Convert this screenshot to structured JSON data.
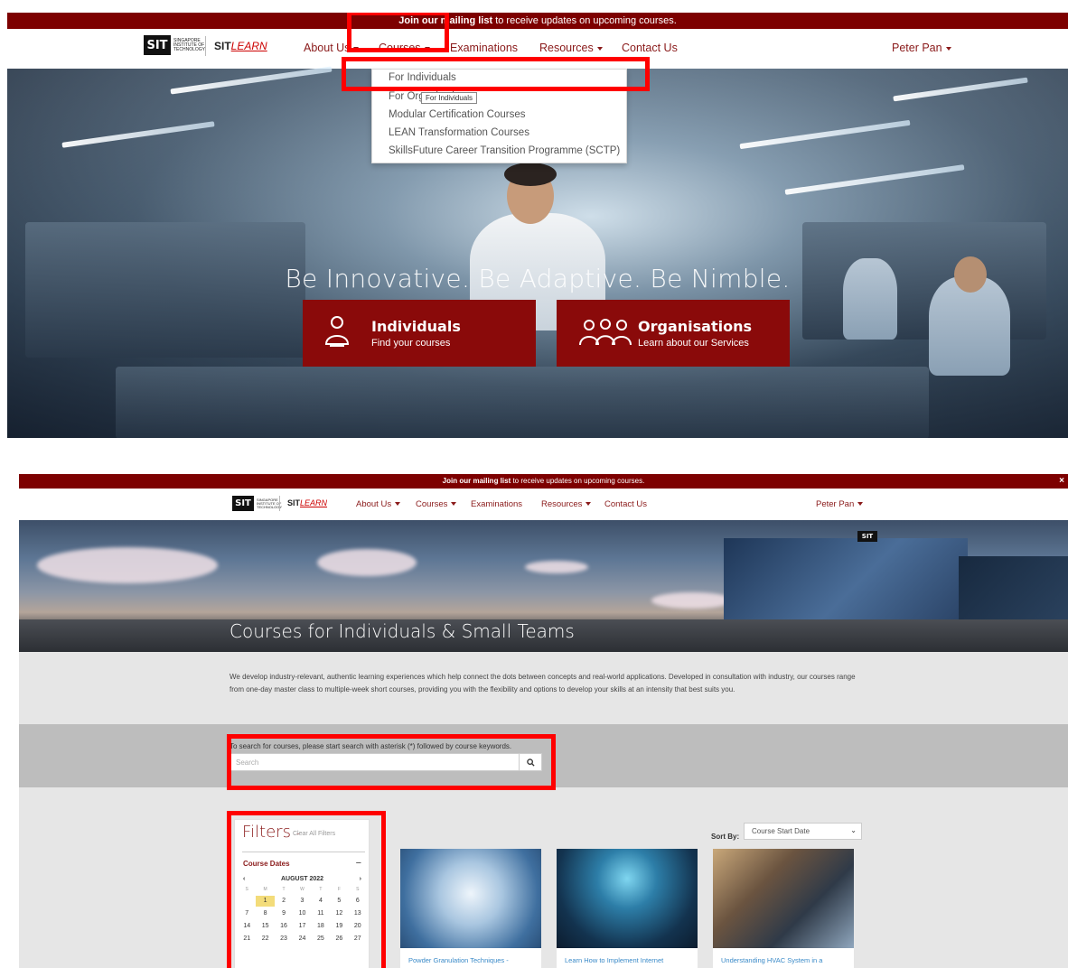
{
  "screenshot1": {
    "banner": {
      "bold": "Join our mailing list",
      "rest": " to receive updates on upcoming courses."
    },
    "logo": {
      "sit": "SIT",
      "institute_lines": [
        "SINGAPORE",
        "INSTITUTE OF",
        "TECHNOLOGY"
      ],
      "sitlearn_bold": "SIT",
      "sitlearn_italic": "LEARN"
    },
    "nav": {
      "about": "About Us",
      "courses": "Courses",
      "examinations": "Examinations",
      "resources": "Resources",
      "contact": "Contact Us",
      "user": "Peter Pan"
    },
    "dropdown": [
      "For Individuals",
      "For Organisations",
      "Modular Certification Courses",
      "LEAN Transformation Courses",
      "SkillsFuture Career Transition Programme (SCTP)"
    ],
    "tooltip": "For Individuals",
    "tagline": "Be Innovative. Be Adaptive. Be Nimble.",
    "cta_individuals": {
      "title": "Individuals",
      "subtitle": "Find your courses"
    },
    "cta_organisations": {
      "title": "Organisations",
      "subtitle": "Learn about our Services"
    }
  },
  "screenshot2": {
    "banner": {
      "bold": "Join our mailing list",
      "rest": " to receive updates on upcoming courses."
    },
    "close": "×",
    "nav": {
      "about": "About Us",
      "courses": "Courses",
      "examinations": "Examinations",
      "resources": "Resources",
      "contact": "Contact Us",
      "user": "Peter Pan"
    },
    "hero_title": "Courses for Individuals & Small Teams",
    "intro": "We develop industry-relevant, authentic learning experiences which help connect the dots between concepts and real-world applications. Developed in consultation with industry, our courses range from one-day master class to multiple-week short courses, providing you with the flexibility and options to develop your skills at an intensity that best suits you.",
    "search": {
      "label": "To search for courses, please start search with asterisk (*) followed by course keywords.",
      "placeholder": "Search"
    },
    "filters": {
      "title": "Filters",
      "dash": "-",
      "clear": "Clear All Filters",
      "course_dates": "Course Dates",
      "toggle": "−"
    },
    "calendar": {
      "month": "AUGUST 2022",
      "prev": "‹",
      "next": "›",
      "days_of_week": [
        "S",
        "M",
        "T",
        "W",
        "T",
        "F",
        "S"
      ],
      "weeks": [
        [
          "",
          "1",
          "2",
          "3",
          "4",
          "5",
          "6"
        ],
        [
          "7",
          "8",
          "9",
          "10",
          "11",
          "12",
          "13"
        ],
        [
          "14",
          "15",
          "16",
          "17",
          "18",
          "19",
          "20"
        ],
        [
          "21",
          "22",
          "23",
          "24",
          "25",
          "26",
          "27"
        ]
      ],
      "selected": "1"
    },
    "sort": {
      "label": "Sort By:",
      "value": "Course Start Date"
    },
    "courses": [
      {
        "title": "Powder Granulation Techniques -"
      },
      {
        "title": "Learn How to Implement Internet"
      },
      {
        "title": "Understanding HVAC System in a"
      }
    ]
  }
}
